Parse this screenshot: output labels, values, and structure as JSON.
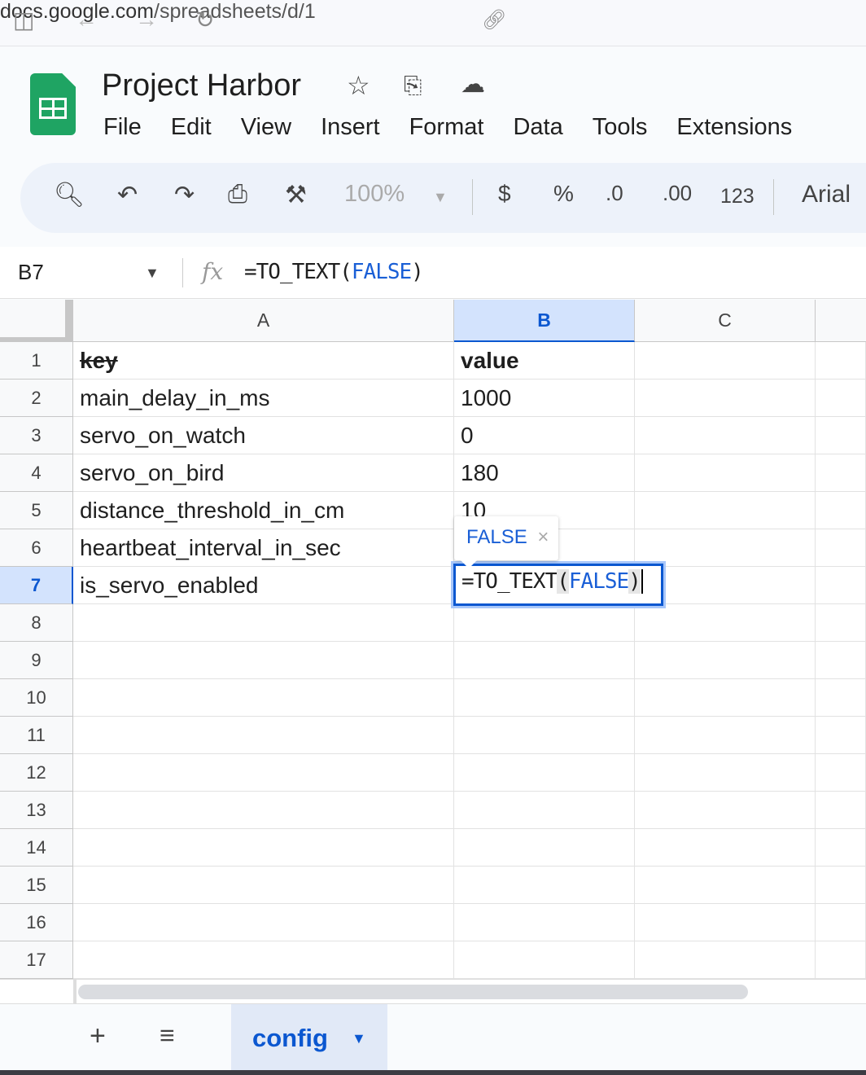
{
  "browser": {
    "url_host": "docs.google.com",
    "url_path": "/spreadsheets/d/1"
  },
  "doc": {
    "title": "Project Harbor"
  },
  "menu": [
    "File",
    "Edit",
    "View",
    "Insert",
    "Format",
    "Data",
    "Tools",
    "Extensions"
  ],
  "toolbar": {
    "zoom": "100%",
    "currency": "$",
    "percent": "%",
    "dec_decrease": ".0",
    "dec_increase": ".00",
    "format_number": "123",
    "font": "Arial"
  },
  "formula_bar": {
    "cell_ref": "B7",
    "fx": "fx",
    "formula_prefix": "=TO_TEXT(",
    "formula_arg": "FALSE",
    "formula_suffix": ")"
  },
  "columns": [
    "A",
    "B",
    "C"
  ],
  "rows": [
    {
      "n": "1",
      "a": "key",
      "b": "value"
    },
    {
      "n": "2",
      "a": "main_delay_in_ms",
      "b": "1000"
    },
    {
      "n": "3",
      "a": "servo_on_watch",
      "b": "0"
    },
    {
      "n": "4",
      "a": "servo_on_bird",
      "b": "180"
    },
    {
      "n": "5",
      "a": "distance_threshold_in_cm",
      "b": "10"
    },
    {
      "n": "6",
      "a": "heartbeat_interval_in_sec",
      "b": ""
    },
    {
      "n": "7",
      "a": "is_servo_enabled",
      "b": ""
    },
    {
      "n": "8"
    },
    {
      "n": "9"
    },
    {
      "n": "10"
    },
    {
      "n": "11"
    },
    {
      "n": "12"
    },
    {
      "n": "13"
    },
    {
      "n": "14"
    },
    {
      "n": "15"
    },
    {
      "n": "16"
    },
    {
      "n": "17"
    }
  ],
  "editor": {
    "prefix": "=TO_TEXT",
    "open": "(",
    "arg": "FALSE",
    "close": ")"
  },
  "tooltip": {
    "value": "FALSE",
    "close": "×"
  },
  "sheets": {
    "active": "config"
  },
  "colors": {
    "accent": "#0b57d0",
    "selected_header": "#d3e3fd",
    "green": "#1fa463"
  }
}
